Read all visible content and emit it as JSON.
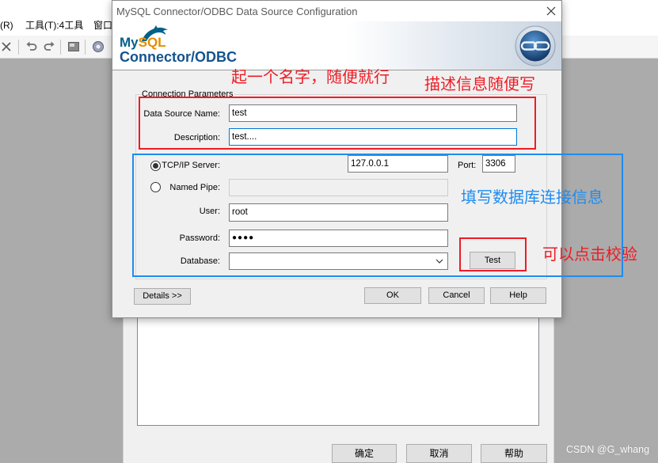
{
  "theme": {
    "desktop": "#ababab",
    "annotation-red": "#ee1c25",
    "annotation-blue": "#1e8cf0",
    "focus-blue": "#0078d7",
    "brand-blue": "#15538f",
    "mysql-blue": "#00618a",
    "mysql-orange": "#e48e00"
  },
  "background": {
    "menu": [
      "(R)",
      "工具(T):4工具",
      "窗口"
    ],
    "toolbar_icons": [
      "close-icon",
      "undo-icon",
      "redo-icon",
      "window-icon",
      "settings-icon"
    ],
    "window_buttons": {
      "confirm": "确定",
      "cancel": "取消",
      "help": "帮助"
    }
  },
  "dialog": {
    "title": "MySQL Connector/ODBC Data Source Configuration",
    "close_icon": "close-icon",
    "banner": {
      "logo_my": "My",
      "logo_sql": "SQL",
      "product": "Connector/ODBC",
      "badge_icon": "chain-link-icon"
    },
    "group_label": "Connection Parameters",
    "dsn": {
      "label": "Data Source Name:",
      "value": "test"
    },
    "description": {
      "label": "Description:",
      "value": "test....",
      "focused": true
    },
    "tcp_ip": {
      "label": "TCP/IP Server:",
      "value": "127.0.0.1",
      "selected": true
    },
    "port": {
      "label": "Port:",
      "value": "3306"
    },
    "named_pipe": {
      "label": "Named Pipe:",
      "value": "",
      "selected": false,
      "disabled": true
    },
    "user": {
      "label": "User:",
      "value": "root"
    },
    "password": {
      "label": "Password:",
      "value": "●●●●"
    },
    "database": {
      "label": "Database:",
      "value": ""
    },
    "buttons": {
      "test": "Test",
      "details": "Details >>",
      "ok": "OK",
      "cancel": "Cancel",
      "help": "Help"
    }
  },
  "annotations": {
    "name_hint": "起一个名字，随便就行",
    "description_hint": "描述信息随便写",
    "connection_hint": "填写数据库连接信息",
    "test_hint": "可以点击校验"
  },
  "watermark": "CSDN @G_whang"
}
